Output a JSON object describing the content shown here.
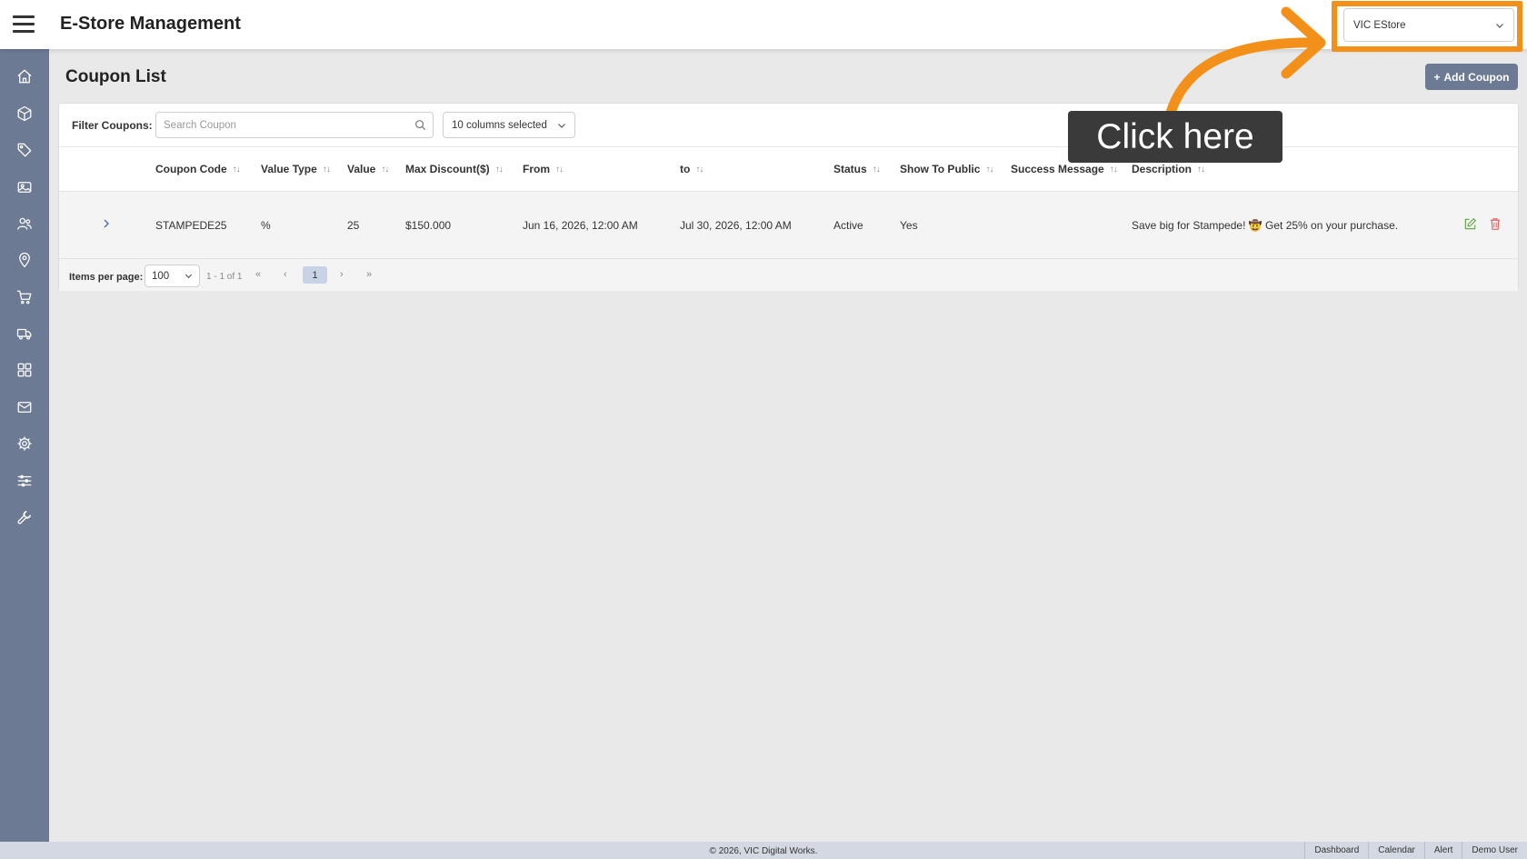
{
  "header": {
    "title": "E-Store Management",
    "store_selector": {
      "value": "VIC EStore"
    }
  },
  "sidebar": {
    "items": [
      {
        "icon": "home-icon"
      },
      {
        "icon": "box-icon"
      },
      {
        "icon": "tag-icon"
      },
      {
        "icon": "image-icon"
      },
      {
        "icon": "users-icon"
      },
      {
        "icon": "location-pin-icon"
      },
      {
        "icon": "cart-icon"
      },
      {
        "icon": "truck-icon"
      },
      {
        "icon": "dashboard-grid-icon"
      },
      {
        "icon": "mail-icon"
      },
      {
        "icon": "gear-icon"
      },
      {
        "icon": "sliders-icon"
      },
      {
        "icon": "wrench-icon"
      }
    ]
  },
  "page": {
    "title": "Coupon List",
    "add_button": "Add Coupon",
    "filter_label": "Filter Coupons:",
    "search_placeholder": "Search Coupon",
    "columns_selected": "10 columns selected"
  },
  "table": {
    "headers": [
      "Coupon Code",
      "Value Type",
      "Value",
      "Max Discount($)",
      "From",
      "to",
      "Status",
      "Show To Public",
      "Success Message",
      "Description"
    ],
    "rows": [
      {
        "coupon_code": "STAMPEDE25",
        "value_type": "%",
        "value": "25",
        "max_discount": "$150.000",
        "from": "Jun 16, 2026, 12:00 AM",
        "to": "Jul 30, 2026, 12:00 AM",
        "status": "Active",
        "show_to_public": "Yes",
        "success_message": "",
        "description": "Save big for Stampede! 🤠 Get 25% on your purchase."
      }
    ]
  },
  "pagination": {
    "items_per_page_label": "Items per page:",
    "items_per_page": "100",
    "range": "1 - 1 of 1",
    "current_page": "1",
    "first": "«",
    "prev": "‹",
    "next": "›",
    "last": "»"
  },
  "annotation": {
    "text": "Click here",
    "color": "#f39019"
  },
  "footer": {
    "copyright": "© 2026, VIC Digital Works.",
    "links": [
      "Dashboard",
      "Calendar",
      "Alert",
      "Demo User"
    ]
  },
  "colors": {
    "sidebar": "#6d7a94",
    "accent": "#6d7a94",
    "edit": "#6aa84f",
    "delete": "#e06666"
  }
}
